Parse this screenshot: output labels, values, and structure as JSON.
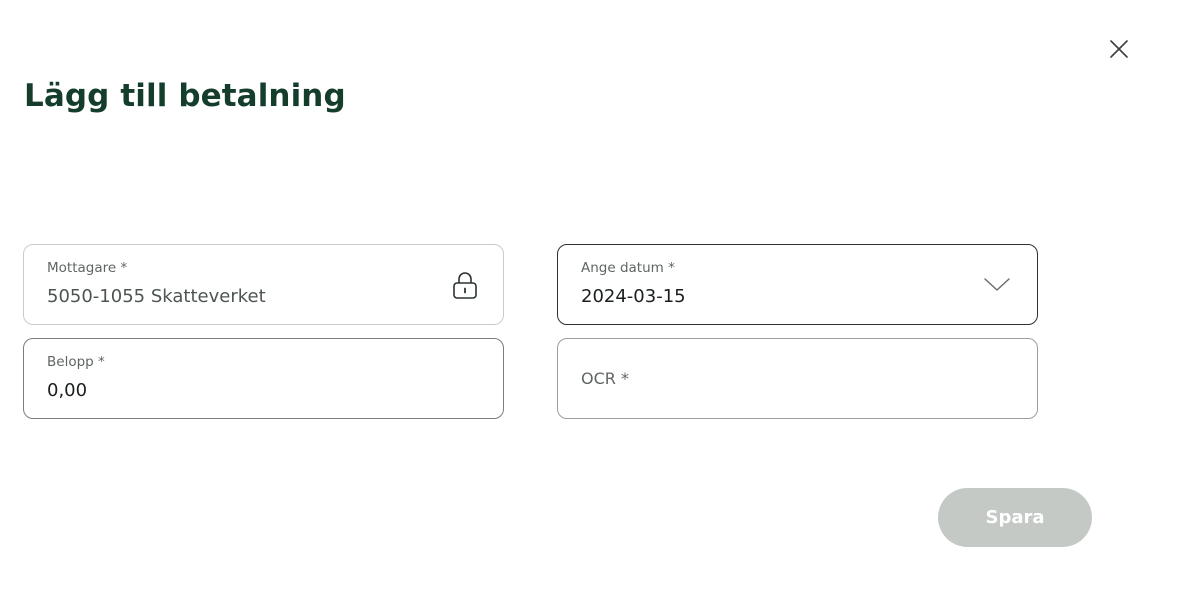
{
  "dialog": {
    "title": "Lägg till betalning",
    "close_icon": "close-icon"
  },
  "fields": {
    "recipient": {
      "label": "Mottagare *",
      "value": "5050-1055 Skatteverket",
      "icon": "lock-icon",
      "locked": true
    },
    "date": {
      "label": "Ange datum *",
      "value": "2024-03-15",
      "icon": "chevron-down-icon"
    },
    "amount": {
      "label": "Belopp *",
      "value": "0,00"
    },
    "ocr": {
      "placeholder": "OCR *",
      "value": ""
    }
  },
  "actions": {
    "save_label": "Spara",
    "save_enabled": false
  },
  "colors": {
    "title": "#143d2c",
    "save_button_disabled": "#c4c9c6",
    "field_border_locked": "#c9ccca",
    "field_border_active": "#7a7e7b"
  }
}
